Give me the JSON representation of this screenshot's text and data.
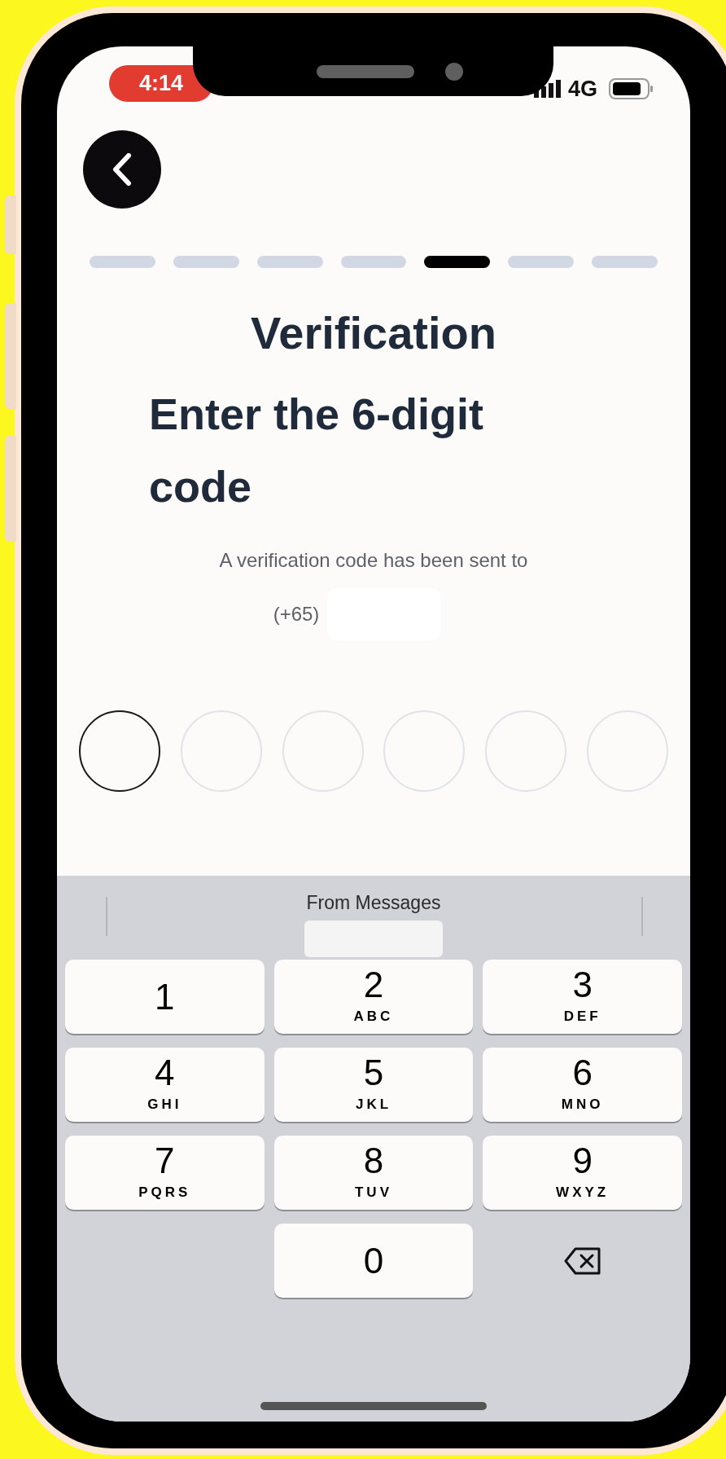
{
  "status_bar": {
    "time": "4:14",
    "network": "4G"
  },
  "progress": [
    {
      "selected": false
    },
    {
      "selected": false
    },
    {
      "selected": false
    },
    {
      "selected": false
    },
    {
      "selected": true
    },
    {
      "selected": false
    },
    {
      "selected": false
    }
  ],
  "title": "Verification",
  "heading": "Enter the 6-digit code",
  "subtitle": "A verification code has been sent to",
  "phone_prefix": "(+65)",
  "otp_cells": [
    {
      "selected": true
    },
    {
      "selected": false
    },
    {
      "selected": false
    },
    {
      "selected": false
    },
    {
      "selected": false
    },
    {
      "selected": false
    }
  ],
  "keyboard": {
    "suggestion_label": "From Messages",
    "rows": [
      [
        {
          "kind": "digit",
          "digit": "1"
        },
        {
          "kind": "digit",
          "digit": "2",
          "letters": "ABC"
        },
        {
          "kind": "digit",
          "digit": "3",
          "letters": "DEF"
        }
      ],
      [
        {
          "kind": "digit",
          "digit": "4",
          "letters": "GHI"
        },
        {
          "kind": "digit",
          "digit": "5",
          "letters": "JKL"
        },
        {
          "kind": "digit",
          "digit": "6",
          "letters": "MNO"
        }
      ],
      [
        {
          "kind": "digit",
          "digit": "7",
          "letters": "PQRS"
        },
        {
          "kind": "digit",
          "digit": "8",
          "letters": "TUV"
        },
        {
          "kind": "digit",
          "digit": "9",
          "letters": "WXYZ"
        }
      ],
      [
        "",
        {
          "kind": "digit",
          "digit": "0"
        },
        {
          "kind": "backspace"
        }
      ]
    ]
  }
}
